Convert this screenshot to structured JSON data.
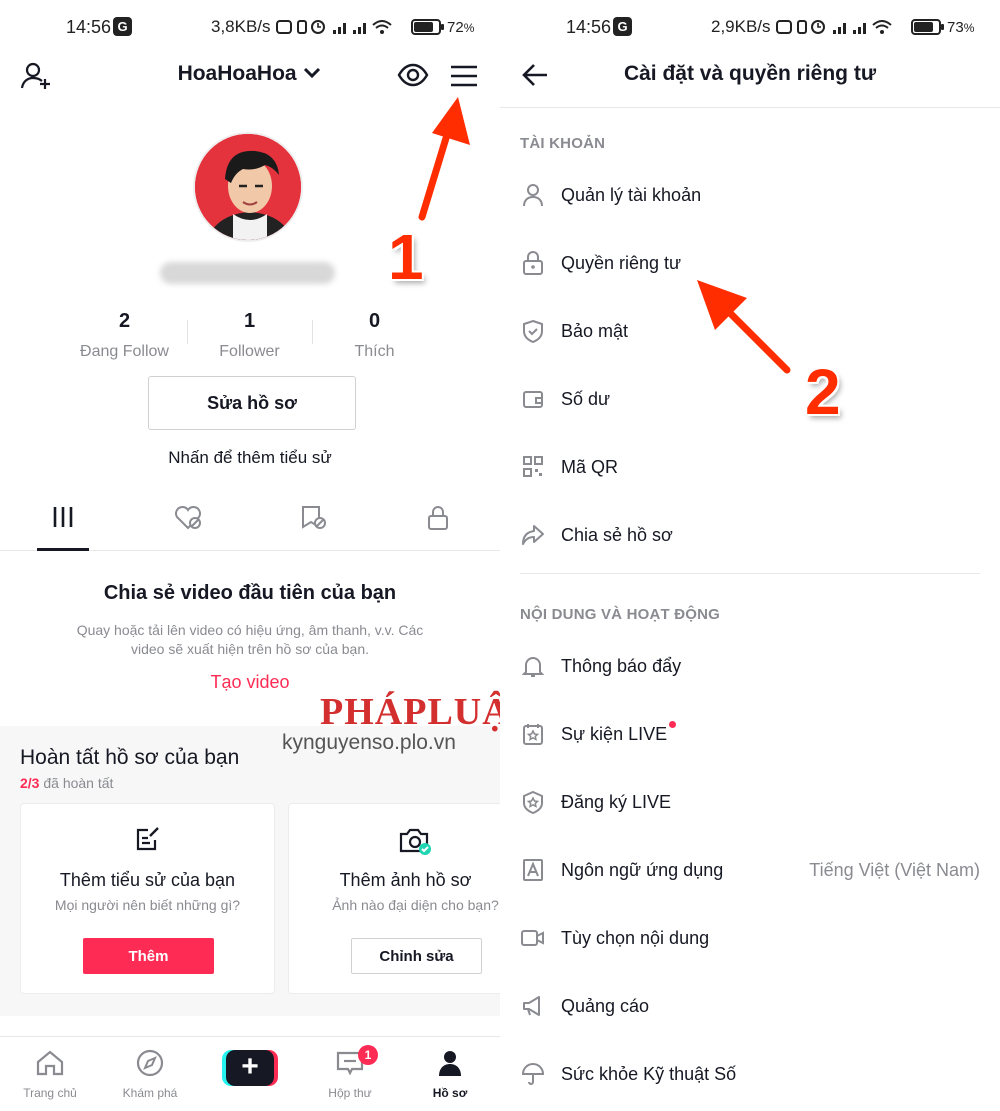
{
  "left": {
    "status": {
      "time": "14:56",
      "g": "G",
      "speed": "3,8KB/s",
      "battery": "72",
      "battery_unit": "%"
    },
    "header": {
      "username": "HoaHoaHoa",
      "add_icon": "add-user-icon",
      "view_icon": "eye-icon",
      "menu_icon": "hamburger-menu-icon"
    },
    "stats": [
      {
        "value": "2",
        "label": "Đang Follow"
      },
      {
        "value": "1",
        "label": "Follower"
      },
      {
        "value": "0",
        "label": "Thích"
      }
    ],
    "edit_profile": "Sửa hồ sơ",
    "bio_prompt": "Nhấn để thêm tiểu sử",
    "tabs": [
      "videos-grid-icon",
      "liked-icon",
      "favorites-icon",
      "private-lock-icon"
    ],
    "share": {
      "title": "Chia sẻ video đầu tiên của bạn",
      "desc": "Quay hoặc tải lên video có hiệu ứng, âm thanh, v.v. Các video sẽ xuất hiện trên hồ sơ của bạn.",
      "link": "Tạo video"
    },
    "complete": {
      "title": "Hoàn tất hồ sơ của bạn",
      "progress": "2/3",
      "progress_suffix": " đã hoàn tất",
      "cards": [
        {
          "title": "Thêm tiểu sử của bạn",
          "desc": "Mọi người nên biết những gì?",
          "button": "Thêm"
        },
        {
          "title": "Thêm ảnh hồ sơ",
          "desc": "Ảnh nào đại diện cho bạn?",
          "button": "Chỉnh sửa"
        }
      ]
    },
    "watermark": {
      "logo_a": "PHÁP",
      "logo_b": "LUẬT",
      "url": "kynguyenso.plo.vn"
    },
    "nav": [
      {
        "label": "Trang chủ",
        "icon": "home-icon"
      },
      {
        "label": "Khám phá",
        "icon": "compass-icon"
      },
      {
        "label": "+",
        "icon": "create-plus-icon"
      },
      {
        "label": "Hộp thư",
        "icon": "inbox-icon",
        "badge": "1"
      },
      {
        "label": "Hồ sơ",
        "icon": "profile-icon"
      }
    ],
    "step": "1"
  },
  "right": {
    "status": {
      "time": "14:56",
      "g": "G",
      "speed": "2,9KB/s",
      "battery": "73",
      "battery_unit": "%"
    },
    "title": "Cài đặt và quyền riêng tư",
    "sections": [
      {
        "header": "TÀI KHOẢN",
        "items": [
          {
            "label": "Quản lý tài khoản",
            "icon": "person-icon"
          },
          {
            "label": "Quyền riêng tư",
            "icon": "lock-icon"
          },
          {
            "label": "Bảo mật",
            "icon": "shield-icon"
          },
          {
            "label": "Số dư",
            "icon": "wallet-icon"
          },
          {
            "label": "Mã QR",
            "icon": "qr-code-icon"
          },
          {
            "label": "Chia sẻ hồ sơ",
            "icon": "share-icon"
          }
        ]
      },
      {
        "header": "NỘI DUNG VÀ HOẠT ĐỘNG",
        "items": [
          {
            "label": "Thông báo đẩy",
            "icon": "bell-icon"
          },
          {
            "label": "Sự kiện LIVE",
            "icon": "calendar-star-icon"
          },
          {
            "label": "Đăng ký LIVE",
            "icon": "badge-star-icon"
          },
          {
            "label": "Ngôn ngữ ứng dụng",
            "icon": "language-icon",
            "value": "Tiếng Việt (Việt Nam)"
          },
          {
            "label": "Tùy chọn nội dung",
            "icon": "video-camera-icon"
          },
          {
            "label": "Quảng cáo",
            "icon": "megaphone-icon"
          },
          {
            "label": "Sức khỏe Kỹ thuật Số",
            "icon": "umbrella-icon"
          }
        ]
      }
    ],
    "step": "2"
  },
  "colors": {
    "accent": "#fe2c55",
    "text": "#161823",
    "muted": "#8a8b91",
    "annotation": "#ff2d00"
  }
}
